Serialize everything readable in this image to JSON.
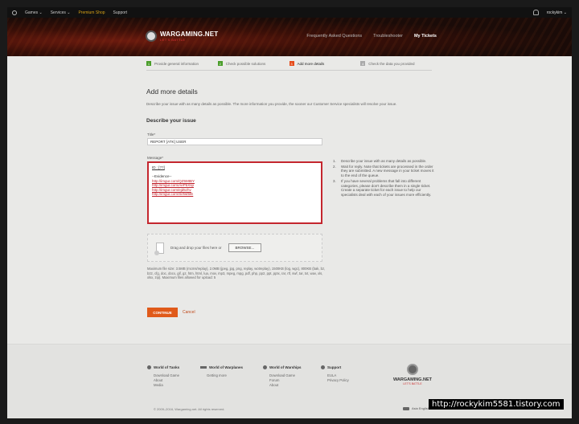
{
  "topnav": {
    "items": [
      "Games ⌄",
      "Services ⌄",
      "Premium Shop",
      "Support"
    ],
    "user": "rockykim ⌄"
  },
  "hero": {
    "logo_name": "WARGAMING.NET",
    "logo_sub": "LET'S BATTLE",
    "nav": [
      "Frequently Asked Questions",
      "Troubleshooter",
      "My Tickets"
    ]
  },
  "steps": [
    {
      "num": "1",
      "label": "Provide general information"
    },
    {
      "num": "2",
      "label": "Check possible solutions"
    },
    {
      "num": "3",
      "label": "Add more details"
    },
    {
      "num": "4",
      "label": "Check the data you provided"
    }
  ],
  "page": {
    "title": "Add more details",
    "description": "Describe your issue with as many details as possible. The more information you provide, the sooner our Customer Service specialists will resolve your issue.",
    "section": "Describe your issue",
    "title_label": "Title*",
    "title_value": "REPORT [ATK] USER",
    "message_label": "Message*",
    "message": {
      "id_line": "ID : [??]",
      "evidence": "--Evidence--",
      "links": [
        "http://imgur.com/QZ5MtBY",
        "http://imgur.com/AePbXsp",
        "http://imgur.com/ejd5zhv",
        "http://imgur.com/Sefwt5IE"
      ]
    }
  },
  "tips": [
    {
      "n": "1.",
      "text": "Describe your issue with as many details as possible."
    },
    {
      "n": "2.",
      "text": "Wait for reply. Note that tickets are processed in the order they are submitted. A new message in your ticket moves it to the end of the queue."
    },
    {
      "n": "3.",
      "text": "If you have several problems that fall into different categories, please don't describe them in a single ticket. Create a separate ticket for each issue to help our specialists deal with each of your issues more efficiently."
    }
  ],
  "upload": {
    "drop_text": "Drag and drop your files here or",
    "browse": "BROWSE...",
    "limits": "Maximum file size: 3.5MB (mcms/replay), 2.0MB (jpeg, jpg, png, replay, wotreplay), 1500KB (log, wgc), 800KB (bak, bz, bz2, cfg, doc, docx, gif, gz, htm, html, lua, mov, mp3, mpeg, mpg, pdf, php, pp2, ppt, pptx, rar, rtf, swf, tar, txt, wav, xls, xlsx, zip). Maximum files allowed for upload: 5"
  },
  "actions": {
    "continue": "CONTINUE",
    "cancel": "Cancel"
  },
  "footer": {
    "columns": [
      {
        "title": "World of Tanks",
        "links": [
          "Download Game",
          "About",
          "Media"
        ]
      },
      {
        "title": "World of Warplanes",
        "links": [
          "Getting more"
        ]
      },
      {
        "title": "World of Warships",
        "links": [
          "Download Game",
          "Forum",
          "About"
        ]
      },
      {
        "title": "Support",
        "links": [
          "EULA",
          "Privacy Policy"
        ]
      }
    ],
    "logo_name": "WARGAMING.NET",
    "logo_sub": "LET'S BATTLE",
    "copyright": "© 2009–2016, Wargaming.net. All rights reserved.",
    "language": "Asia English"
  },
  "watermark": "http://rockykim5581.tistory.com"
}
